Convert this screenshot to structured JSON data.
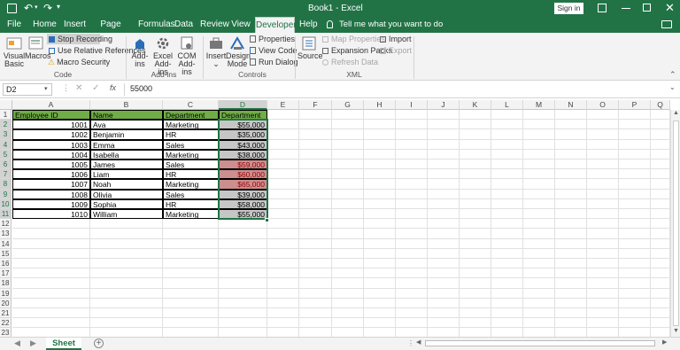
{
  "window": {
    "title": "Book1 - Excel",
    "sign_in": "Sign in"
  },
  "tabs": [
    "File",
    "Home",
    "Insert",
    "Page Layout",
    "Formulas",
    "Data",
    "Review",
    "View",
    "Developer",
    "Help"
  ],
  "tell_me": "Tell me what you want to do",
  "ribbon": {
    "code": {
      "visual_basic_1": "Visual",
      "visual_basic_2": "Basic",
      "macros": "Macros",
      "stop_recording": "Stop Recording",
      "relative_refs": "Use Relative References",
      "macro_security": "Macro Security",
      "label": "Code"
    },
    "addins": {
      "addins_1": "Add-",
      "addins_2": "ins",
      "excel_addins_1": "Excel",
      "excel_addins_2": "Add-ins",
      "com_addins_1": "COM",
      "com_addins_2": "Add-ins",
      "label": "Add-ins"
    },
    "controls": {
      "insert": "Insert",
      "insert_arrow": "⌄",
      "design_mode_1": "Design",
      "design_mode_2": "Mode",
      "properties": "Properties",
      "view_code": "View Code",
      "run_dialog": "Run Dialog",
      "label": "Controls"
    },
    "xml": {
      "source": "Source",
      "map_properties": "Map Properties",
      "expansion_packs": "Expansion Packs",
      "refresh_data": "Refresh Data",
      "import": "Import",
      "export": "Export",
      "label": "XML"
    }
  },
  "formula_bar": {
    "name_box": "D2",
    "fx": "fx",
    "value": "55000"
  },
  "columns": [
    "A",
    "B",
    "C",
    "D",
    "E",
    "F",
    "G",
    "H",
    "I",
    "J",
    "K",
    "L",
    "M",
    "N",
    "O",
    "P",
    "Q"
  ],
  "rows": [
    "1",
    "2",
    "3",
    "4",
    "5",
    "6",
    "7",
    "8",
    "9",
    "10",
    "11",
    "12",
    "13",
    "14",
    "15",
    "16",
    "17",
    "18",
    "19",
    "20",
    "21",
    "22",
    "23"
  ],
  "headers": {
    "a": "Employee ID",
    "b": "Name",
    "c": "Department",
    "d": "Department"
  },
  "table": [
    {
      "id": "1001",
      "name": "Ava",
      "dept": "Marketing",
      "salary": "$55,000"
    },
    {
      "id": "1002",
      "name": "Benjamin",
      "dept": "HR",
      "salary": "$35,000"
    },
    {
      "id": "1003",
      "name": "Emma",
      "dept": "Sales",
      "salary": "$43,000"
    },
    {
      "id": "1004",
      "name": "Isabella",
      "dept": "Marketing",
      "salary": "$38,000"
    },
    {
      "id": "1005",
      "name": "James",
      "dept": "Sales",
      "salary": "$59,000"
    },
    {
      "id": "1006",
      "name": "Liam",
      "dept": "HR",
      "salary": "$60,000"
    },
    {
      "id": "1007",
      "name": "Noah",
      "dept": "Marketing",
      "salary": "$65,000"
    },
    {
      "id": "1008",
      "name": "Olivia",
      "dept": "Sales",
      "salary": "$39,000"
    },
    {
      "id": "1009",
      "name": "Sophia",
      "dept": "HR",
      "salary": "$58,000"
    },
    {
      "id": "1010",
      "name": "William",
      "dept": "Marketing",
      "salary": "$55,000"
    }
  ],
  "highlight_rows": [
    4,
    5,
    6
  ],
  "colors": {
    "accent": "#217346",
    "header_fill": "#70ad47",
    "highlight": "#cc8e8e",
    "selection": "#c6c6c6"
  },
  "sheet": {
    "tab": "Sheet",
    "add": "+"
  }
}
